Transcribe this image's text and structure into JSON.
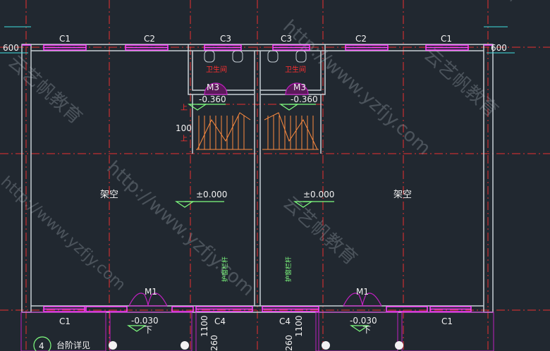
{
  "window_labels": {
    "c1": "C1",
    "c2": "C2",
    "c3": "C3",
    "c4": "C4"
  },
  "door_labels": {
    "m1": "M1",
    "m3": "M3"
  },
  "dimensions": {
    "d600": "600",
    "d100": "100",
    "d1100": "1100",
    "d260": "260"
  },
  "rooms": {
    "open_space": "架空",
    "bathroom": "卫生间"
  },
  "elevations": {
    "ground": "±0.000",
    "bath": "-0.360",
    "entry": "-0.030"
  },
  "stair": {
    "up": "上",
    "down": "下"
  },
  "annotations": {
    "railing": "护窗栏杆",
    "step_detail": "台阶详见",
    "detail_number": "4"
  },
  "watermark": {
    "url": "http://www.yzfjy.com",
    "brand": "云艺帆教育",
    "fragment": "yzfjy"
  },
  "colors": {
    "background": "#212830",
    "wall": "#c8cfd6",
    "window": "#ff40ff",
    "door": "#c020c0",
    "axis": "#ff3030",
    "elevation": "#80ff80",
    "dimension": "#40e0e0"
  }
}
